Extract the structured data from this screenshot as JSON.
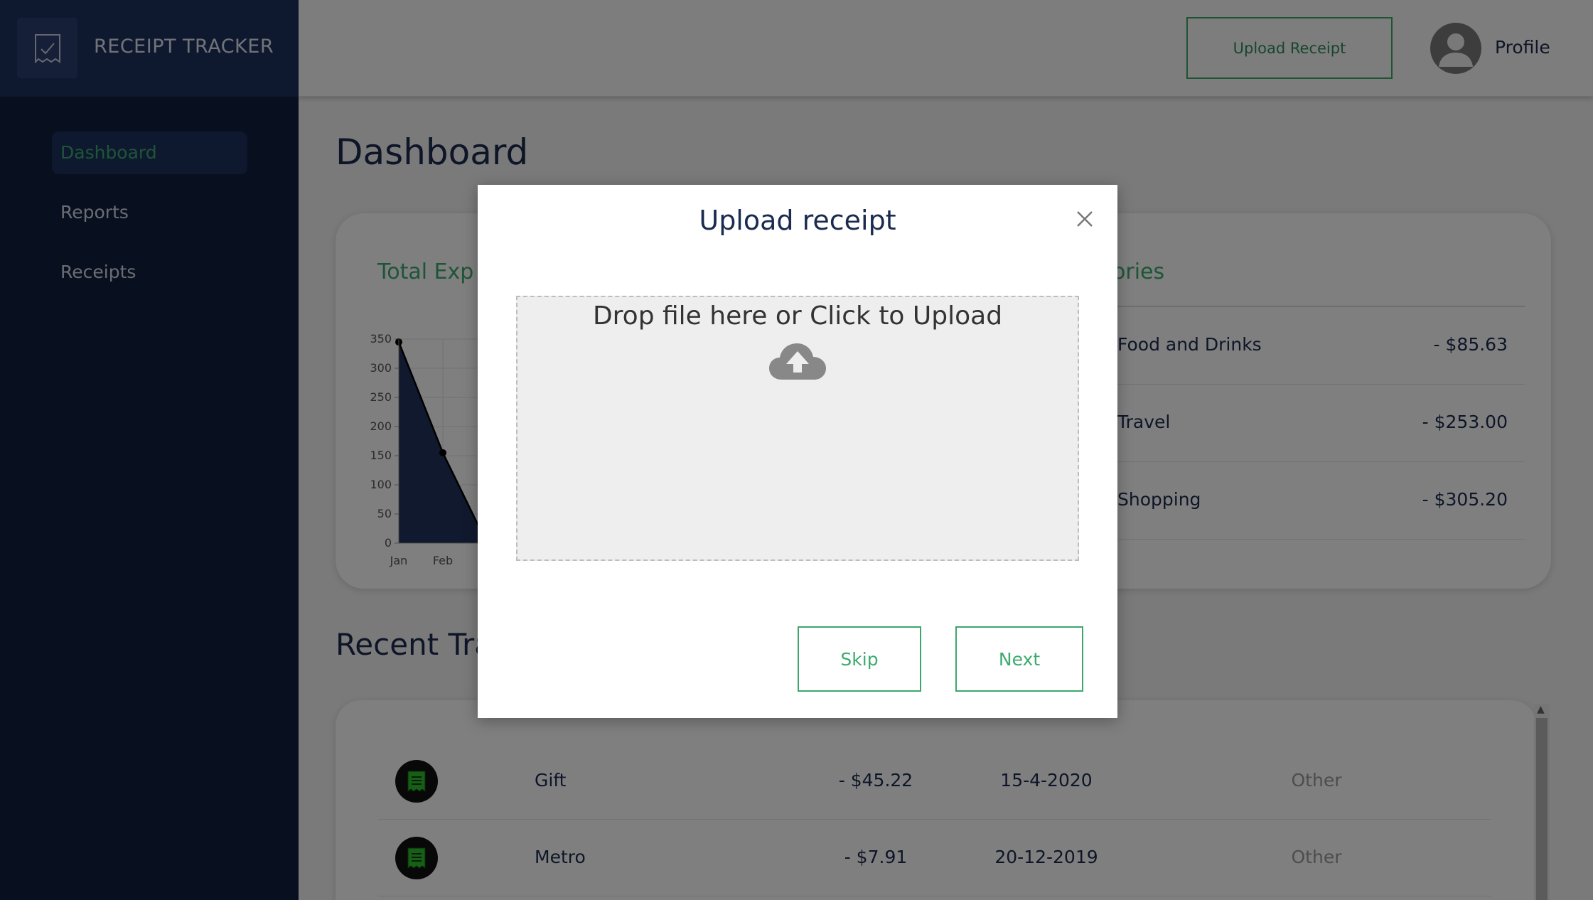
{
  "brand": {
    "title": "RECEIPT TRACKER",
    "logo_icon": "receipt-icon"
  },
  "sidebar": {
    "items": [
      {
        "label": "Dashboard",
        "active": true
      },
      {
        "label": "Reports",
        "active": false
      },
      {
        "label": "Receipts",
        "active": false
      }
    ]
  },
  "header": {
    "upload_label": "Upload Receipt",
    "profile_label": "Profile",
    "avatar_icon": "user-avatar-icon"
  },
  "main": {
    "title": "Dashboard",
    "expenses_title": "Total Exp",
    "categories_title": "ories",
    "recent_title": "Recent Tra"
  },
  "categories": [
    {
      "name": "Food and Drinks",
      "amount": "- $85.63"
    },
    {
      "name": "Travel",
      "amount": "- $253.00"
    },
    {
      "name": "Shopping",
      "amount": "- $305.20"
    }
  ],
  "transactions": [
    {
      "name": "Gift",
      "amount": "- $45.22",
      "date": "15-4-2020",
      "category": "Other",
      "icon": "receipt-icon"
    },
    {
      "name": "Metro",
      "amount": "- $7.91",
      "date": "20-12-2019",
      "category": "Other",
      "icon": "receipt-icon"
    }
  ],
  "chart_data": {
    "type": "area",
    "categories": [
      "Jan",
      "Feb"
    ],
    "values": [
      345,
      155
    ],
    "y_ticks": [
      "0",
      "50",
      "100",
      "150",
      "200",
      "250",
      "300",
      "350"
    ],
    "ylim": [
      0,
      350
    ],
    "grid": true,
    "fill_color": "#22335c",
    "line_color": "#000000"
  },
  "modal": {
    "title": "Upload receipt",
    "dropzone_text": "Drop file here or Click to Upload",
    "skip_label": "Skip",
    "next_label": "Next",
    "close_icon": "close-icon",
    "upload_icon": "cloud-upload-icon"
  },
  "colors": {
    "sidebar": "#112040",
    "brand_bar": "#1d3361",
    "accent_green": "#3daa6e",
    "text_navy": "#1a2b4f"
  }
}
